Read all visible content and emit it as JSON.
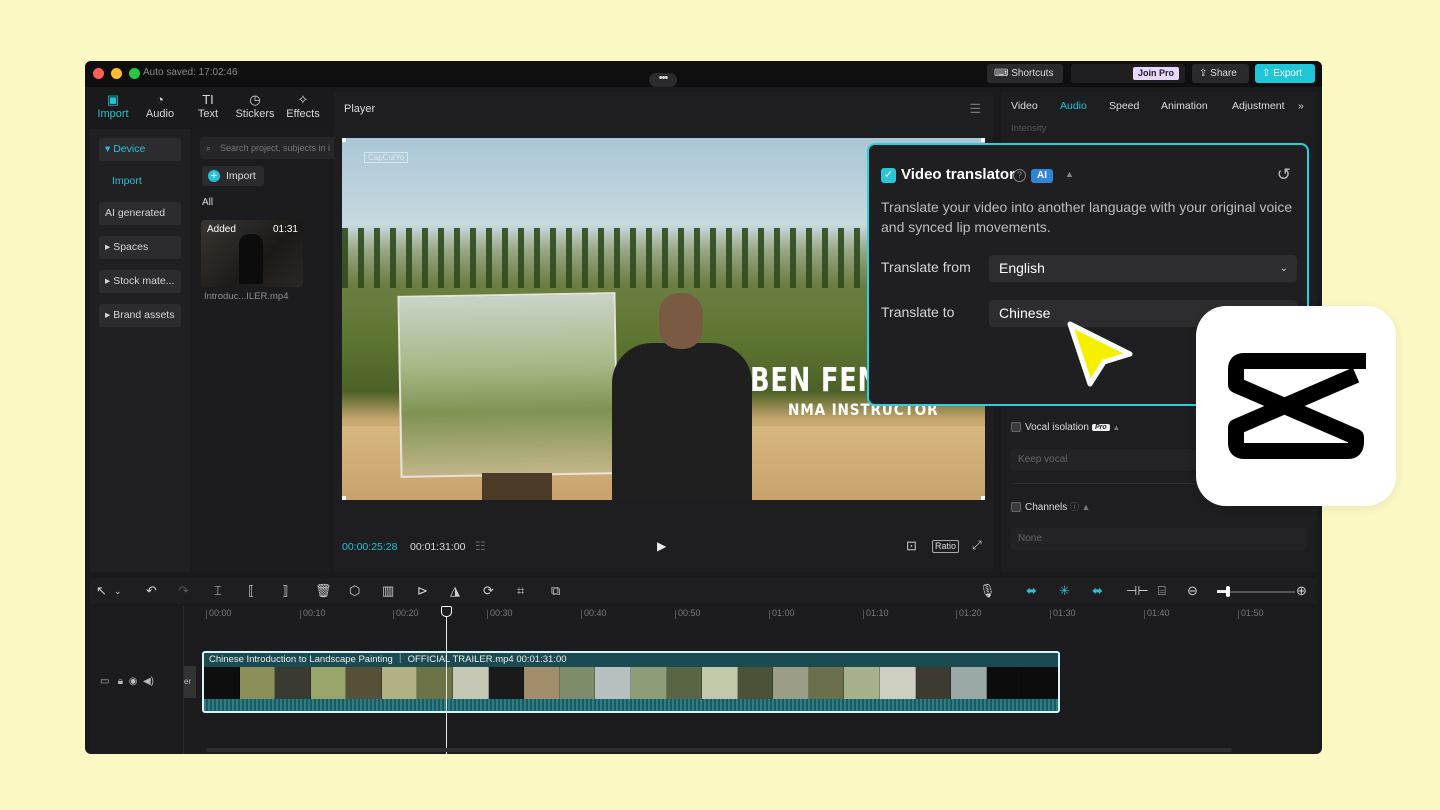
{
  "titlebar": {
    "autosave": "Auto saved: 17:02:46",
    "more": "•••",
    "shortcuts": "Shortcuts",
    "join_pro": "Join Pro",
    "share": "Share",
    "export": "Export"
  },
  "media_tabs": [
    {
      "label": "Import",
      "icon": "import-icon"
    },
    {
      "label": "Audio",
      "icon": "audio-icon"
    },
    {
      "label": "Text",
      "icon": "text-icon",
      "glyph": "TI"
    },
    {
      "label": "Stickers",
      "icon": "sticker-icon"
    },
    {
      "label": "Effects",
      "icon": "effects-icon"
    }
  ],
  "sidebar": {
    "device": "▾ Device",
    "import": "Import",
    "ai_generated": "AI generated",
    "spaces": "▸ Spaces",
    "stock": "▸ Stock mate...",
    "brand": "▸ Brand assets"
  },
  "media": {
    "search_placeholder": "Search project, subjects in i",
    "import_label": "Import",
    "all_label": "All",
    "thumb_added": "Added",
    "thumb_duration": "01:31",
    "thumb_name": "Introduc...ILER.mp4"
  },
  "player": {
    "title": "Player",
    "watermark": "CapCutYo",
    "overlay_name": "BEN FEN",
    "overlay_role": "NMA INSTRUCTOR",
    "current_time": "00:00:25:28",
    "total_time": "00:01:31:00",
    "ratio": "Ratio"
  },
  "right_panel": {
    "tabs": [
      "Video",
      "Audio",
      "Speed",
      "Animation",
      "Adjustment"
    ],
    "active_tab": "Audio",
    "intensity": "Intensity",
    "vocal_isolation": "Vocal isolation",
    "pro_badge": "Pro",
    "keep_vocal": "Keep vocal",
    "channels": "Channels",
    "channels_value": "None"
  },
  "translator": {
    "title": "Video translator",
    "ai_badge": "AI",
    "description": "Translate your video into another language with your original voice and synced lip movements.",
    "from_label": "Translate from",
    "from_value": "English",
    "to_label": "Translate to",
    "to_value": "Chinese"
  },
  "timeline": {
    "ruler": [
      "00:00",
      "00:10",
      "00:20",
      "00:30",
      "00:40",
      "00:50",
      "01:00",
      "01:10",
      "01:20",
      "01:30",
      "01:40",
      "01:50"
    ],
    "clip_label": "Chinese   Introduction to Landscape Painting ｜ OFFICIAL TRAILER.mp4   00:01:31:00",
    "track_tag": "er"
  },
  "colors": {
    "accent": "#25c2d4",
    "background": "#fbf8c4",
    "cursor": "#f5f000"
  }
}
